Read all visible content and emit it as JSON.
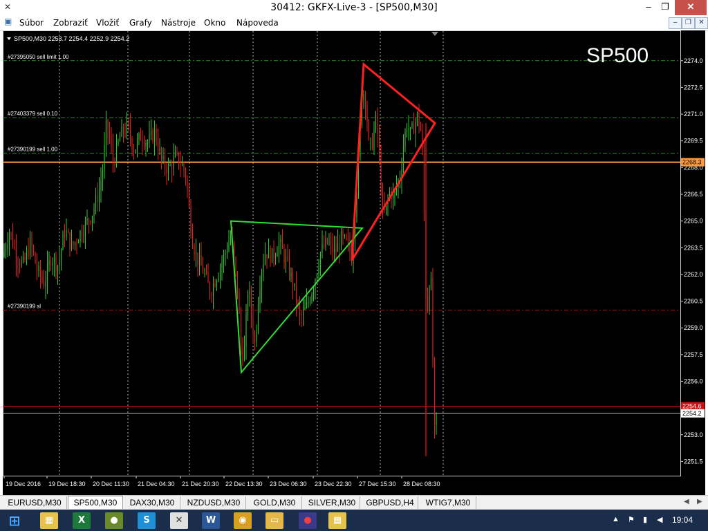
{
  "window": {
    "title": "30412: GKFX-Live-3 - [SP500,M30]",
    "minimize": "–",
    "restore": "❐",
    "close": "✕"
  },
  "menu": [
    "Súbor",
    "Zobraziť",
    "Vložiť",
    "Grafy",
    "Nástroje",
    "Okno",
    "Nápoveda"
  ],
  "mdi": {
    "minimize": "–",
    "restore": "❐",
    "close": "✕"
  },
  "chart_header": "SP500,M30  2253.7 2254.4 2252.9 2254.2",
  "symbol_label": "SP500",
  "price_axis": [
    "2274.0",
    "2272.5",
    "2271.0",
    "2269.5",
    "2268.0",
    "2266.5",
    "2265.0",
    "2263.5",
    "2262.0",
    "2260.5",
    "2259.0",
    "2257.5",
    "2256.0",
    "2254.5",
    "2253.0",
    "2251.5"
  ],
  "time_axis": [
    "19 Dec 2016",
    "19 Dec 18:30",
    "20 Dec 11:30",
    "21 Dec 04:30",
    "21 Dec 20:30",
    "22 Dec 13:30",
    "23 Dec 06:30",
    "23 Dec 22:30",
    "27 Dec 15:30",
    "28 Dec 08:30"
  ],
  "order_lines": [
    {
      "label": "#27395050 sell limit 1.00",
      "price": 2274.0
    },
    {
      "label": "#27403379 sell 0.10",
      "price": 2270.8
    },
    {
      "label": "#27390199 sell 1.00",
      "price": 2268.8
    },
    {
      "label": "#27390199 sl",
      "price": 2260.0
    }
  ],
  "price_tags": {
    "orange": "2268.3",
    "red": "2254.6",
    "bid": "2254.2"
  },
  "colors": {
    "background": "#000000",
    "bull": "#2ec62e",
    "bear": "#e02020",
    "orange_line": "#ff9a3c",
    "red_line": "#d01010",
    "green_dash": "#2a8a2a",
    "red_dash": "#a01818",
    "triangle_green": "#33dd33",
    "triangle_red": "#ff2020",
    "grid": "#b8b8b8"
  },
  "chart_data": {
    "type": "candlestick",
    "title": "SP500",
    "ylim": [
      2250.7,
      2275.7
    ],
    "order_levels": [
      2274.0,
      2270.8,
      2268.8,
      2260.0
    ],
    "orange_level": 2268.3,
    "red_level": 2254.6,
    "bid_level": 2254.2,
    "price_path": [
      [
        0,
        2263.0
      ],
      [
        10,
        2264.5
      ],
      [
        20,
        2263.0
      ],
      [
        30,
        2262.5
      ],
      [
        40,
        2263.8
      ],
      [
        50,
        2262.2
      ],
      [
        60,
        2261.5
      ],
      [
        70,
        2263.0
      ],
      [
        80,
        2262.5
      ],
      [
        90,
        2264.5
      ],
      [
        100,
        2263.5
      ],
      [
        110,
        2264.2
      ],
      [
        120,
        2264.8
      ],
      [
        130,
        2265.5
      ],
      [
        140,
        2266.8
      ],
      [
        145,
        2268.0
      ],
      [
        150,
        2270.5
      ],
      [
        155,
        2269.5
      ],
      [
        160,
        2268.2
      ],
      [
        170,
        2269.8
      ],
      [
        180,
        2270.3
      ],
      [
        190,
        2269.0
      ],
      [
        200,
        2269.8
      ],
      [
        210,
        2269.4
      ],
      [
        220,
        2270.0
      ],
      [
        230,
        2268.3
      ],
      [
        240,
        2267.9
      ],
      [
        250,
        2268.6
      ],
      [
        260,
        2268.1
      ],
      [
        265,
        2267.5
      ],
      [
        270,
        2265.5
      ],
      [
        275,
        2263.8
      ],
      [
        280,
        2263.0
      ],
      [
        290,
        2262.2
      ],
      [
        300,
        2261.0
      ],
      [
        310,
        2262.0
      ],
      [
        320,
        2263.0
      ],
      [
        330,
        2264.2
      ],
      [
        340,
        2261.0
      ],
      [
        345,
        2257.5
      ],
      [
        350,
        2257.8
      ],
      [
        355,
        2261.5
      ],
      [
        360,
        2259.5
      ],
      [
        365,
        2258.0
      ],
      [
        370,
        2261.0
      ],
      [
        375,
        2262.5
      ],
      [
        380,
        2263.3
      ],
      [
        390,
        2263.0
      ],
      [
        400,
        2263.8
      ],
      [
        410,
        2262.7
      ],
      [
        420,
        2261.5
      ],
      [
        425,
        2260.5
      ],
      [
        430,
        2259.5
      ],
      [
        440,
        2260.2
      ],
      [
        450,
        2261.5
      ],
      [
        460,
        2263.3
      ],
      [
        470,
        2263.8
      ],
      [
        480,
        2263.2
      ],
      [
        490,
        2264.0
      ],
      [
        500,
        2263.6
      ],
      [
        505,
        2262.9
      ],
      [
        510,
        2266.0
      ],
      [
        515,
        2268.5
      ],
      [
        520,
        2272.5
      ],
      [
        525,
        2271.8
      ],
      [
        530,
        2269.0
      ],
      [
        535,
        2269.5
      ],
      [
        540,
        2270.8
      ],
      [
        545,
        2268.2
      ],
      [
        550,
        2265.2
      ],
      [
        555,
        2265.8
      ],
      [
        560,
        2266.7
      ],
      [
        565,
        2266.3
      ],
      [
        570,
        2267.0
      ],
      [
        575,
        2267.5
      ],
      [
        580,
        2269.5
      ],
      [
        585,
        2270.5
      ],
      [
        590,
        2269.8
      ],
      [
        595,
        2270.4
      ],
      [
        600,
        2270.9
      ],
      [
        605,
        2270.0
      ],
      [
        608,
        2268.0
      ],
      [
        612,
        2261.0
      ],
      [
        615,
        2260.0
      ],
      [
        618,
        2262.5
      ],
      [
        620,
        2261.0
      ],
      [
        623,
        2255.0
      ],
      [
        625,
        2252.5
      ],
      [
        627,
        2253.8
      ]
    ],
    "green_triangle": [
      [
        330,
        2265.0
      ],
      [
        520,
        2264.6
      ],
      [
        345,
        2256.5
      ]
    ],
    "red_triangle": [
      [
        522,
        2273.8
      ],
      [
        625,
        2270.5
      ],
      [
        505,
        2262.8
      ]
    ],
    "vertical_marker": {
      "x": 612,
      "from": 2270.5,
      "to": 2251.8
    }
  },
  "tabs": [
    "EURUSD,M30",
    "SP500,M30",
    "DAX30,M30",
    "NZDUSD,M30",
    "GOLD,M30",
    "SILVER,M30",
    "GBPUSD,H4",
    "WTIG7,M30"
  ],
  "active_tab": "SP500,M30",
  "taskbar": {
    "clock": "19:04"
  }
}
